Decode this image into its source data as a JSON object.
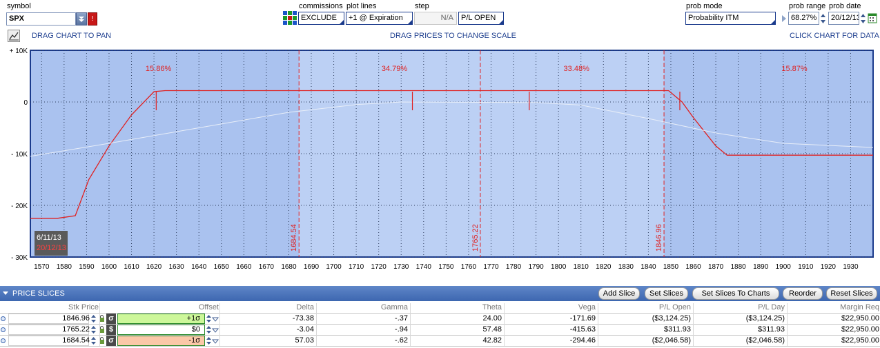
{
  "toolbar": {
    "symbol_label": "symbol",
    "symbol_value": "SPX",
    "commissions_label": "commissions",
    "commissions_value": "EXCLUDE",
    "plot_lines_label": "plot lines",
    "plot_lines_value": "+1 @ Expiration",
    "step_label": "step",
    "step_value": "N/A",
    "pl_mode_value": "P/L OPEN",
    "prob_mode_label": "prob mode",
    "prob_mode_value": "Probability ITM",
    "prob_range_label": "prob range",
    "prob_range_value": "68.27%",
    "prob_date_label": "prob date",
    "prob_date_value": "20/12/13"
  },
  "hints": {
    "pan": "DRAG CHART TO PAN",
    "scale": "DRAG PRICES TO CHANGE SCALE",
    "data": "CLICK CHART FOR DATA"
  },
  "chart_data": {
    "type": "line",
    "xlim": [
      1565,
      1940
    ],
    "ylim": [
      -30000,
      10000
    ],
    "x_ticks": [
      1570,
      1580,
      1590,
      1600,
      1610,
      1620,
      1630,
      1640,
      1650,
      1660,
      1670,
      1680,
      1690,
      1700,
      1710,
      1720,
      1730,
      1740,
      1750,
      1760,
      1770,
      1780,
      1790,
      1800,
      1810,
      1820,
      1830,
      1840,
      1850,
      1860,
      1870,
      1880,
      1890,
      1900,
      1910,
      1920,
      1930
    ],
    "y_ticks": [
      {
        "value": 10000,
        "label": "+ 10K"
      },
      {
        "value": 0,
        "label": "0"
      },
      {
        "value": -10000,
        "label": "- 10K"
      },
      {
        "value": -20000,
        "label": "- 20K"
      },
      {
        "value": -30000,
        "label": "- 30K"
      }
    ],
    "colors": {
      "expiration": "#e02020",
      "current": "#e8eef8",
      "zone_text": "#e02020"
    },
    "series": [
      {
        "x": [
          1565,
          1577,
          1585,
          1591,
          1600,
          1610,
          1620,
          1625,
          1849,
          1855,
          1860,
          1870,
          1875,
          1940
        ],
        "values": [
          -22500,
          -22500,
          -22000,
          -15000,
          -8500,
          -2500,
          2000,
          2200,
          2200,
          0,
          -3000,
          -8500,
          -10300,
          -10300
        ]
      },
      {
        "x": [
          1565,
          1600,
          1640,
          1680,
          1710,
          1730,
          1790,
          1810,
          1840,
          1870,
          1900,
          1940
        ],
        "values": [
          -10500,
          -8000,
          -5000,
          -2000,
          -500,
          0,
          -100,
          -600,
          -3200,
          -6000,
          -8000,
          -8800
        ]
      }
    ],
    "zones": [
      {
        "label": "15.86%",
        "x": 1622
      },
      {
        "label": "34.79%",
        "x": 1727
      },
      {
        "label": "33.48%",
        "x": 1808
      },
      {
        "label": "15.87%",
        "x": 1905
      }
    ],
    "price_lines": [
      {
        "value": 1684.54,
        "label": "1684.54"
      },
      {
        "value": 1765.22,
        "label": "1765.22"
      },
      {
        "value": 1846.96,
        "label": "1846.96"
      }
    ],
    "strike_ticks": [
      1621,
      1735,
      1787,
      1854
    ],
    "date_badge": {
      "date1": "6/11/13",
      "date2": "20/12/13"
    }
  },
  "price_slices": {
    "title": "PRICE SLICES",
    "buttons": [
      "Add Slice",
      "Set Slices",
      "Set Slices To Charts",
      "Reorder",
      "Reset Slices"
    ],
    "columns": [
      "Stk Price",
      "Offset",
      "Delta",
      "Gamma",
      "Theta",
      "Vega",
      "P/L Open",
      "P/L Day",
      "Margin Req"
    ],
    "rows": [
      {
        "stk": "1846.96",
        "mode": "σ",
        "offset": "+1σ",
        "offset_color": "#cdf79a",
        "delta": "-73.38",
        "gamma": "-.37",
        "theta": "24.00",
        "vega": "-171.69",
        "pl_open": "($3,124.25)",
        "pl_day": "($3,124.25)",
        "margin": "$22,950.00"
      },
      {
        "stk": "1765.22",
        "mode": "$",
        "offset": "$0",
        "offset_color": "#ffffff",
        "delta": "-3.04",
        "gamma": "-.94",
        "theta": "57.48",
        "vega": "-415.63",
        "pl_open": "$311.93",
        "pl_day": "$311.93",
        "margin": "$22,950.00"
      },
      {
        "stk": "1684.54",
        "mode": "σ",
        "offset": "-1σ",
        "offset_color": "#fbc8a8",
        "delta": "57.03",
        "gamma": "-.62",
        "theta": "42.82",
        "vega": "-294.46",
        "pl_open": "($2,046.58)",
        "pl_day": "($2,046.58)",
        "margin": "$22,950.00"
      }
    ]
  }
}
